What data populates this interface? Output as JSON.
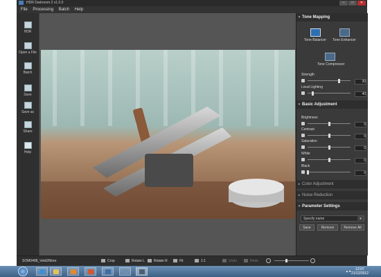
{
  "window": {
    "title": "HDR Darkroom 2 v1.0.0",
    "controls": {
      "minimize": "–",
      "maximize": "□",
      "close": "✕"
    }
  },
  "menu": [
    "File",
    "Processing",
    "Batch",
    "Help"
  ],
  "toolbar": [
    {
      "label": "HDR",
      "icon": "hdr-icon"
    },
    {
      "label": "Open a File",
      "icon": "open-file-icon"
    },
    {
      "label": "Batch",
      "icon": "batch-icon"
    },
    {
      "label": "Save",
      "icon": "save-icon"
    },
    {
      "label": "Save as",
      "icon": "save-as-icon"
    },
    {
      "label": "Share",
      "icon": "share-icon"
    },
    {
      "label": "Help",
      "icon": "help-icon"
    }
  ],
  "panel": {
    "tone_mapping": {
      "header": "Tone Mapping",
      "modes": [
        "Tone Balancer",
        "Tone Enhancer",
        "Tone Compressor"
      ],
      "selected": "Tone Balancer",
      "sliders": [
        {
          "label": "Strength",
          "value": "30",
          "level": 0.72
        },
        {
          "label": "Local Lighting",
          "value": "40",
          "level": 0.12
        }
      ]
    },
    "basic_adjustment": {
      "header": "Basic Adjustment",
      "sliders": [
        {
          "label": "Brightness",
          "value": "0",
          "level": 0.5
        },
        {
          "label": "Contrast",
          "value": "0",
          "level": 0.5
        },
        {
          "label": "Saturation",
          "value": "0",
          "level": 0.5
        },
        {
          "label": "White",
          "value": "0",
          "level": 0.5
        },
        {
          "label": "Black",
          "value": "0",
          "level": 0.0
        }
      ]
    },
    "color_adjustment": {
      "header": "Color Adjustment"
    },
    "noise_reduction": {
      "header": "Noise Reduction"
    },
    "parameter_settings": {
      "header": "Parameter Settings",
      "name_placeholder": "Specify name",
      "buttons": [
        "Save",
        "Remove",
        "Remove All"
      ]
    }
  },
  "status": {
    "filename": "SOM0488_Vetd2More",
    "buttons": [
      {
        "label": "Crop",
        "enabled": true
      },
      {
        "label": "Rotate L",
        "enabled": true
      },
      {
        "label": "Rotate R",
        "enabled": true
      },
      {
        "label": "Fit",
        "enabled": true
      },
      {
        "label": "1:1",
        "enabled": true
      },
      {
        "label": "Undo",
        "enabled": false
      },
      {
        "label": "Redo",
        "enabled": false
      }
    ],
    "zoom_level": 0.33
  },
  "taskbar": {
    "apps": [
      "ie-icon",
      "folder-icon",
      "media-player-icon",
      "firefox-icon",
      "app-icon",
      "app-icon",
      "hdr-darkroom-icon"
    ],
    "time": "12:07",
    "date": "21/12/2012"
  },
  "colors": {
    "accent": "#2f6fb0",
    "panel": "#3a3a3a",
    "toolbar": "#2f2f2f"
  }
}
